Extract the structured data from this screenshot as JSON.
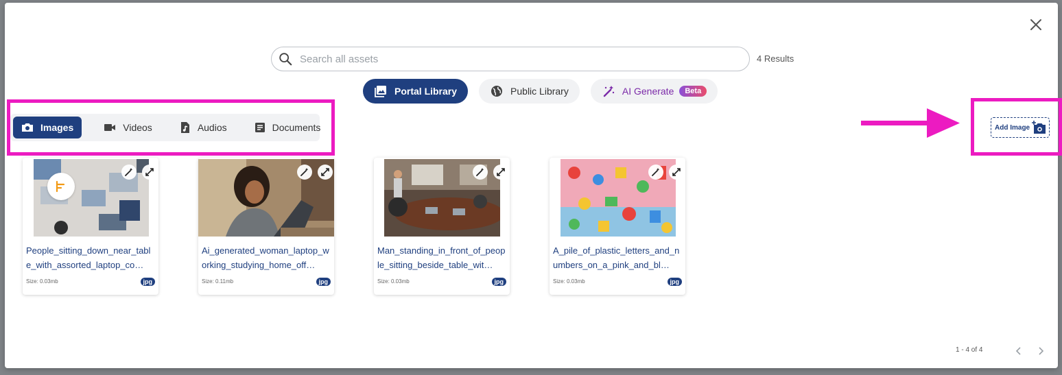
{
  "search": {
    "placeholder": "Search all assets",
    "value": "",
    "results_label": "4 Results"
  },
  "library_tabs": [
    {
      "label": "Portal Library",
      "active": true,
      "icon": "image-library-icon"
    },
    {
      "label": "Public Library",
      "active": false,
      "icon": "globe-icon"
    },
    {
      "label": "AI Generate",
      "active": false,
      "icon": "magic-wand-icon",
      "badge": "Beta"
    }
  ],
  "type_tabs": [
    {
      "label": "Images",
      "active": true,
      "icon": "camera-icon"
    },
    {
      "label": "Videos",
      "active": false,
      "icon": "video-camera-icon"
    },
    {
      "label": "Audios",
      "active": false,
      "icon": "audio-file-icon"
    },
    {
      "label": "Documents",
      "active": false,
      "icon": "document-icon"
    }
  ],
  "add_image": {
    "label": "Add Image",
    "icon": "add-photo-icon"
  },
  "assets": [
    {
      "title": "People_sitting_down_near_table_with_assorted_laptop_co…",
      "size": "Size: 0.03mb",
      "type": "jpg"
    },
    {
      "title": "Ai_generated_woman_laptop_working_studying_home_off…",
      "size": "Size: 0.11mb",
      "type": "jpg"
    },
    {
      "title": "Man_standing_in_front_of_people_sitting_beside_table_wit…",
      "size": "Size: 0.03mb",
      "type": "jpg"
    },
    {
      "title": "A_pile_of_plastic_letters_and_numbers_on_a_pink_and_bl…",
      "size": "Size: 0.03mb",
      "type": "jpg"
    }
  ],
  "pagination": {
    "label": "1 - 4 of 4"
  },
  "colors": {
    "primary": "#1f3f7f",
    "highlight": "#ec1bc1",
    "ai_purple": "#7b2aa8"
  }
}
